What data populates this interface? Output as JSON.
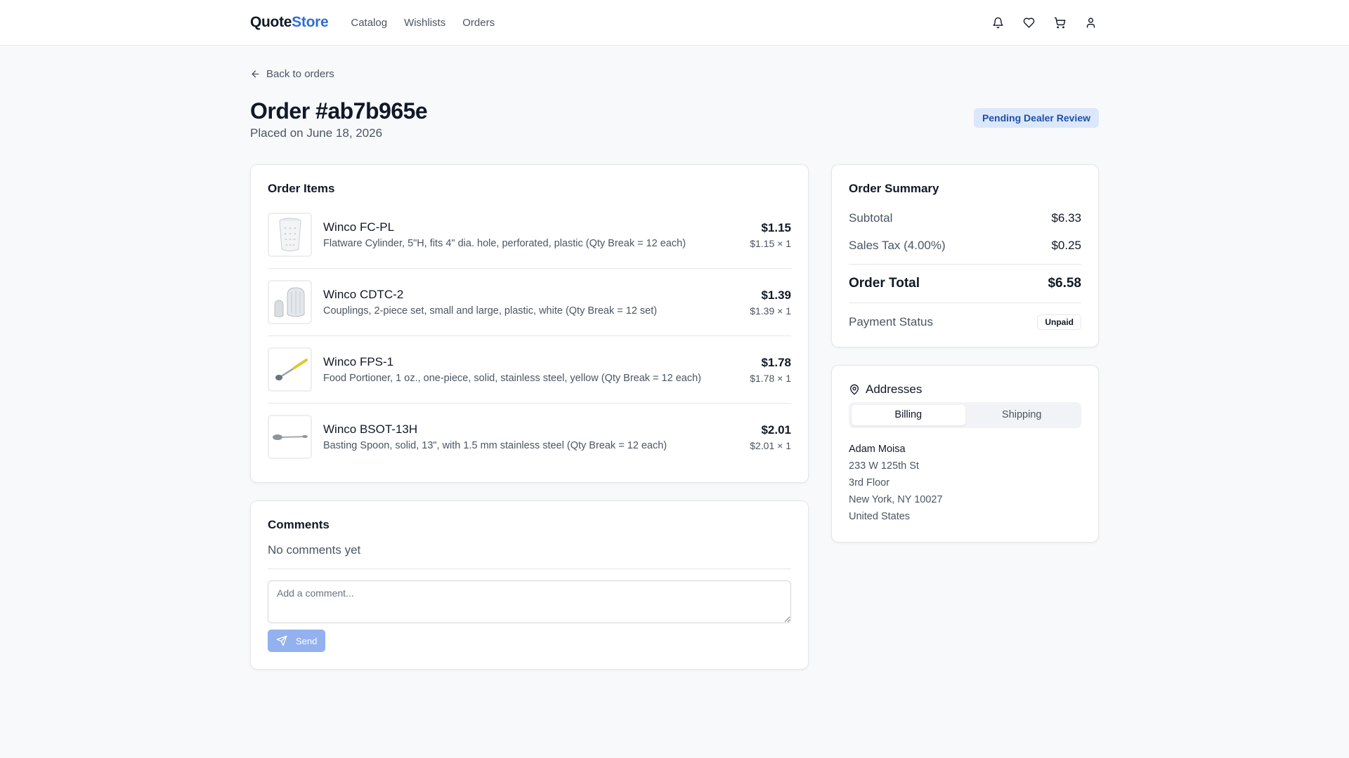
{
  "brand": {
    "part1": "Quote",
    "part2": "Store"
  },
  "nav": [
    "Catalog",
    "Wishlists",
    "Orders"
  ],
  "header_icons": [
    "bell-icon",
    "heart-icon",
    "cart-icon",
    "user-icon"
  ],
  "back_label": "Back to orders",
  "order": {
    "title": "Order #ab7b965e",
    "placed": "Placed on June 18, 2026",
    "status": "Pending Dealer Review"
  },
  "items_card": {
    "title": "Order Items",
    "items": [
      {
        "name": "Winco FC-PL",
        "desc": "Flatware Cylinder, 5\"H, fits 4\" dia. hole, perforated, plastic (Qty Break = 12 each)",
        "price": "$1.15",
        "qty": "$1.15 × 1"
      },
      {
        "name": "Winco CDTC-2",
        "desc": "Couplings, 2-piece set, small and large, plastic, white (Qty Break = 12 set)",
        "price": "$1.39",
        "qty": "$1.39 × 1"
      },
      {
        "name": "Winco FPS-1",
        "desc": "Food Portioner, 1 oz., one-piece, solid, stainless steel, yellow (Qty Break = 12 each)",
        "price": "$1.78",
        "qty": "$1.78 × 1"
      },
      {
        "name": "Winco BSOT-13H",
        "desc": "Basting Spoon, solid, 13\", with 1.5 mm stainless steel (Qty Break = 12 each)",
        "price": "$2.01",
        "qty": "$2.01 × 1"
      }
    ]
  },
  "comments": {
    "title": "Comments",
    "empty": "No comments yet",
    "placeholder": "Add a comment...",
    "send_label": "Send"
  },
  "summary": {
    "title": "Order Summary",
    "subtotal_label": "Subtotal",
    "subtotal": "$6.33",
    "tax_label": "Sales Tax (4.00%)",
    "tax": "$0.25",
    "total_label": "Order Total",
    "total": "$6.58",
    "payment_label": "Payment Status",
    "payment_status": "Unpaid"
  },
  "addresses": {
    "title": "Addresses",
    "tabs": [
      "Billing",
      "Shipping"
    ],
    "active_tab": "Billing",
    "name": "Adam Moisa",
    "line1": "233 W 125th St",
    "line2": "3rd Floor",
    "city": "New York, NY 10027",
    "country": "United States"
  },
  "colors": {
    "accent": "#2f6fd6",
    "status_bg": "#dbe8fb",
    "status_text": "#1f4fa8",
    "send_button": "#93b1ef"
  }
}
